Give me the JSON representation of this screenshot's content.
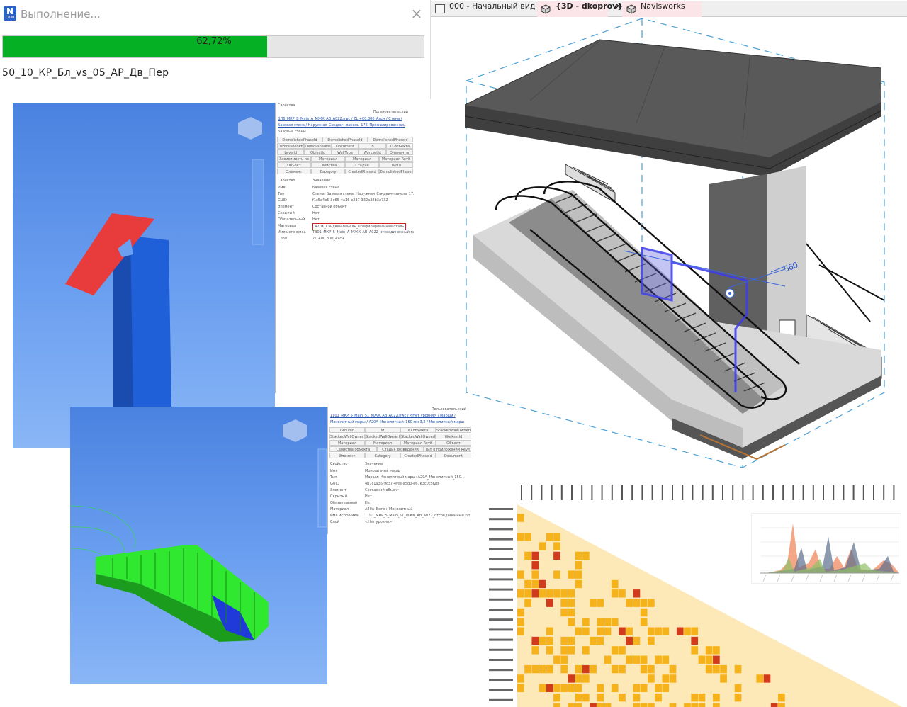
{
  "dialog": {
    "title": "Выполнение...",
    "close_glyph": "×",
    "progress_label": "62,72%",
    "progress_fraction": 0.6272,
    "file_name": "50_10_КР_Бл_vs_05_АР_Дв_Пер",
    "logo_letter": "N",
    "logo_caption": "CBIM"
  },
  "tabs": [
    {
      "label": "000 - Начальный вид"
    },
    {
      "label": "{3D - dkoprov}"
    },
    {
      "label": "Navisworks"
    }
  ],
  "view3d": {
    "dimension_label": "560"
  },
  "shot1": {
    "panel_title": "Свойства",
    "user": "Пользовательский",
    "path1": "ВЛ6_МКР_В_Main_А_МЖК_АВ_А022.nwc / ZL +00.300_Ахсн / Стена /",
    "path2": "Базовая стена / Наружная_Сэндвич-панель_176_Профилированная/",
    "path3": "Базовые стены",
    "headers_row1": [
      "DemolishedPhaseId",
      "DemolishedPhaseId",
      "DemolishedPhaseId"
    ],
    "headers_row2": [
      "DemolishedPhaseId",
      "DemolishedPhaseId",
      "Document",
      "Id",
      "ID объекта"
    ],
    "headers_row3": [
      "Levelid",
      "ObjectId",
      "WallType",
      "WorksetId",
      "Элементы категории"
    ],
    "headers_row4": [
      "Зависимость по гнезду",
      "Материал",
      "Материал Autodesk",
      "Материал Revit"
    ],
    "headers_row5": [
      "Объект",
      "Свойства объекта",
      "Стадия возведения",
      "Тип в приложении Revit"
    ],
    "headers_row6": [
      "Элемент",
      "Category",
      "CreatedPhaseId",
      "DemolishedPhaseId"
    ],
    "col_prop": "Свойство",
    "col_val": "Значение",
    "rows": [
      [
        "Имя",
        "Базовая стена"
      ],
      [
        "Тип",
        "Стены: Базовая стена: Наружная_Сэндвич-панель_17..."
      ],
      [
        "GUID",
        "f1c5a4b5-3e65-4a16-b237-362a38b3a732"
      ],
      [
        "Элемент",
        "Составной объект"
      ],
      [
        "Скрытый",
        "Нет"
      ],
      [
        "Обязательный",
        "Нет"
      ],
      [
        "Материал",
        "А20Х_Сэндвич-панель_Профилированная сталь"
      ],
      [
        "Имя источника",
        "ТВ01_МКР_5_Main_А_МЖК_АВ_А022_отсоединенный.rvt"
      ],
      [
        "Слой",
        "ZL +00.300_Ахсн"
      ]
    ]
  },
  "shot2": {
    "user": "Пользовательский",
    "path1": "1101_МКР_5_Main_51_МЖК_АВ_А022.nwc / <Нет уровня> / Марши /",
    "path2": "Монолитный марш / А20А_Монолитный_150 мм 3,2 / Монолитный марш",
    "headers_row1": [
      "GroupId",
      "Id",
      "ID объекта",
      "StackedWallOwnerId"
    ],
    "headers_row2": [
      "StackedWallOwnerId",
      "StackedWallOwnerId",
      "StackedWallOwnerId",
      "WorksetId"
    ],
    "headers_row3": [
      "Материал",
      "Материал Autodesk",
      "Материал Revit",
      "Объект"
    ],
    "headers_row4": [
      "Свойства объекта",
      "Стадия возведения",
      "Тип в приложении Revit"
    ],
    "headers_row5": [
      "Элемент",
      "Category",
      "CreatedPhaseId",
      "Document"
    ],
    "col_prop": "Свойство",
    "col_val": "Значение",
    "rows": [
      [
        "Имя",
        "Монолитный марш"
      ],
      [
        "Тип",
        "Марши: Монолитный марш: А20А_Монолитный_150..."
      ],
      [
        "GUID",
        "4b7c1935-9c37-4fee-a5d0-e67e3c0c5f2d"
      ],
      [
        "Элемент",
        "Составной объект"
      ],
      [
        "Скрытый",
        "Нет"
      ],
      [
        "Обязательный",
        "Нет"
      ],
      [
        "Материал",
        "А20А_Бетон_Монолитный"
      ],
      [
        "Имя источника",
        "1101_МКР_5_Main_51_МЖК_АВ_А022_отсоединенный.rvt"
      ],
      [
        "Слой",
        "<Нет уровня>"
      ]
    ]
  },
  "colors": {
    "progress": "#06b025",
    "viewport_blue": "#4a82e0",
    "red_plate": "#e83c3c",
    "blue_column": "#1f5fd8",
    "green_stair": "#2fe82f",
    "matrix_low": "#fde8b8",
    "matrix_mid": "#f5b21a",
    "matrix_high": "#d13a1a"
  }
}
